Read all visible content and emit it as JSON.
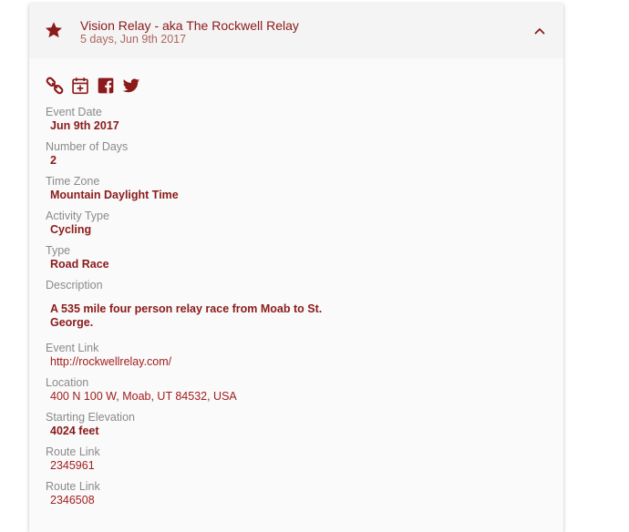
{
  "event": {
    "title": "Vision Relay - aka The Rockwell Relay",
    "subtitle": "5 days, Jun 9th 2017"
  },
  "icons": {
    "favorite": "star-icon",
    "collapse": "chevron-up-icon",
    "actions": [
      "link-icon",
      "calendar-add-icon",
      "facebook-icon",
      "twitter-icon"
    ],
    "accent_color": "#8b1a1a"
  },
  "details": {
    "event_date": {
      "label": "Event Date",
      "value": "Jun 9th 2017"
    },
    "number_of_days": {
      "label": "Number of Days",
      "value": "2"
    },
    "time_zone": {
      "label": "Time Zone",
      "value": "Mountain Daylight Time"
    },
    "activity_type": {
      "label": "Activity Type",
      "value": "Cycling"
    },
    "type": {
      "label": "Type",
      "value": "Road Race"
    },
    "description": {
      "label": "Description",
      "value": "A 535 mile four person relay race from Moab to St. George."
    },
    "event_link": {
      "label": "Event Link",
      "value": "http://rockwellrelay.com/"
    },
    "location": {
      "label": "Location",
      "value": "400 N 100 W, Moab, UT 84532, USA"
    },
    "starting_elevation": {
      "label": "Starting Elevation",
      "value": "4024 feet"
    },
    "route_link_1": {
      "label": "Route Link",
      "value": "2345961"
    },
    "route_link_2": {
      "label": "Route Link",
      "value": "2346508"
    }
  }
}
